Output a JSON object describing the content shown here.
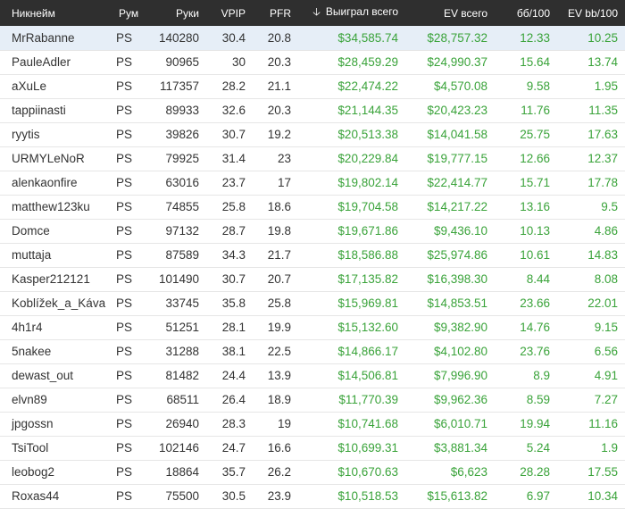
{
  "colors": {
    "header_bg": "#2f2f2f",
    "money": "#3aa33a",
    "highlight": "#e6eef7"
  },
  "header": {
    "nick": "Никнейм",
    "room": "Рум",
    "hands": "Руки",
    "vpip": "VPIP",
    "pfr": "PFR",
    "won": "Выиграл всего",
    "won_sort_icon": "arrow-down-icon",
    "ev": "EV всего",
    "bb100": "бб/100",
    "evbb100": "EV bb/100"
  },
  "rows": [
    {
      "nick": "MrRabanne",
      "room": "PS",
      "hands": "140280",
      "vpip": "30.4",
      "pfr": "20.8",
      "won": "$34,585.74",
      "ev": "$28,757.32",
      "bb": "12.33",
      "evbb": "10.25"
    },
    {
      "nick": "PauleAdler",
      "room": "PS",
      "hands": "90965",
      "vpip": "30",
      "pfr": "20.3",
      "won": "$28,459.29",
      "ev": "$24,990.37",
      "bb": "15.64",
      "evbb": "13.74"
    },
    {
      "nick": "aXuLe",
      "room": "PS",
      "hands": "117357",
      "vpip": "28.2",
      "pfr": "21.1",
      "won": "$22,474.22",
      "ev": "$4,570.08",
      "bb": "9.58",
      "evbb": "1.95"
    },
    {
      "nick": "tappiinasti",
      "room": "PS",
      "hands": "89933",
      "vpip": "32.6",
      "pfr": "20.3",
      "won": "$21,144.35",
      "ev": "$20,423.23",
      "bb": "11.76",
      "evbb": "11.35"
    },
    {
      "nick": "ryytis",
      "room": "PS",
      "hands": "39826",
      "vpip": "30.7",
      "pfr": "19.2",
      "won": "$20,513.38",
      "ev": "$14,041.58",
      "bb": "25.75",
      "evbb": "17.63"
    },
    {
      "nick": "URMYLeNoR",
      "room": "PS",
      "hands": "79925",
      "vpip": "31.4",
      "pfr": "23",
      "won": "$20,229.84",
      "ev": "$19,777.15",
      "bb": "12.66",
      "evbb": "12.37"
    },
    {
      "nick": "alenkaonfire",
      "room": "PS",
      "hands": "63016",
      "vpip": "23.7",
      "pfr": "17",
      "won": "$19,802.14",
      "ev": "$22,414.77",
      "bb": "15.71",
      "evbb": "17.78"
    },
    {
      "nick": "matthew123ku",
      "room": "PS",
      "hands": "74855",
      "vpip": "25.8",
      "pfr": "18.6",
      "won": "$19,704.58",
      "ev": "$14,217.22",
      "bb": "13.16",
      "evbb": "9.5"
    },
    {
      "nick": "Domce",
      "room": "PS",
      "hands": "97132",
      "vpip": "28.7",
      "pfr": "19.8",
      "won": "$19,671.86",
      "ev": "$9,436.10",
      "bb": "10.13",
      "evbb": "4.86"
    },
    {
      "nick": "muttaja",
      "room": "PS",
      "hands": "87589",
      "vpip": "34.3",
      "pfr": "21.7",
      "won": "$18,586.88",
      "ev": "$25,974.86",
      "bb": "10.61",
      "evbb": "14.83"
    },
    {
      "nick": "Kasper212121",
      "room": "PS",
      "hands": "101490",
      "vpip": "30.7",
      "pfr": "20.7",
      "won": "$17,135.82",
      "ev": "$16,398.30",
      "bb": "8.44",
      "evbb": "8.08"
    },
    {
      "nick": "Koblížek_a_Káva",
      "room": "PS",
      "hands": "33745",
      "vpip": "35.8",
      "pfr": "25.8",
      "won": "$15,969.81",
      "ev": "$14,853.51",
      "bb": "23.66",
      "evbb": "22.01"
    },
    {
      "nick": "4h1r4",
      "room": "PS",
      "hands": "51251",
      "vpip": "28.1",
      "pfr": "19.9",
      "won": "$15,132.60",
      "ev": "$9,382.90",
      "bb": "14.76",
      "evbb": "9.15"
    },
    {
      "nick": "5nakee",
      "room": "PS",
      "hands": "31288",
      "vpip": "38.1",
      "pfr": "22.5",
      "won": "$14,866.17",
      "ev": "$4,102.80",
      "bb": "23.76",
      "evbb": "6.56"
    },
    {
      "nick": "dewast_out",
      "room": "PS",
      "hands": "81482",
      "vpip": "24.4",
      "pfr": "13.9",
      "won": "$14,506.81",
      "ev": "$7,996.90",
      "bb": "8.9",
      "evbb": "4.91"
    },
    {
      "nick": "elvn89",
      "room": "PS",
      "hands": "68511",
      "vpip": "26.4",
      "pfr": "18.9",
      "won": "$11,770.39",
      "ev": "$9,962.36",
      "bb": "8.59",
      "evbb": "7.27"
    },
    {
      "nick": "jpgossn",
      "room": "PS",
      "hands": "26940",
      "vpip": "28.3",
      "pfr": "19",
      "won": "$10,741.68",
      "ev": "$6,010.71",
      "bb": "19.94",
      "evbb": "11.16"
    },
    {
      "nick": "TsiTool",
      "room": "PS",
      "hands": "102146",
      "vpip": "24.7",
      "pfr": "16.6",
      "won": "$10,699.31",
      "ev": "$3,881.34",
      "bb": "5.24",
      "evbb": "1.9"
    },
    {
      "nick": "leobog2",
      "room": "PS",
      "hands": "18864",
      "vpip": "35.7",
      "pfr": "26.2",
      "won": "$10,670.63",
      "ev": "$6,623",
      "bb": "28.28",
      "evbb": "17.55"
    },
    {
      "nick": "Roxas44",
      "room": "PS",
      "hands": "75500",
      "vpip": "30.5",
      "pfr": "23.9",
      "won": "$10,518.53",
      "ev": "$15,613.82",
      "bb": "6.97",
      "evbb": "10.34"
    }
  ]
}
